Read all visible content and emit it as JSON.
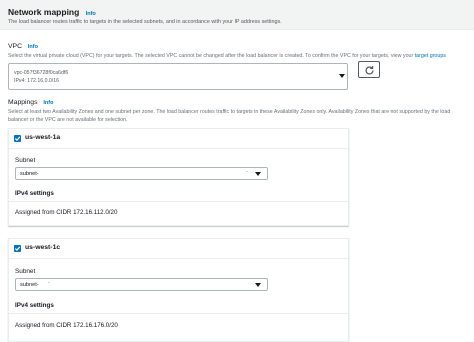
{
  "section": {
    "title": "Network mapping",
    "info": "Info",
    "description": "The load balancer routes traffic to targets in the selected subnets, and in accordance with your IP address settings."
  },
  "vpc": {
    "label": "VPC",
    "info": "Info",
    "description_before": "Select the virtual private cloud (VPC) for your targets. The selected VPC cannot be changed after the load balancer is created. To confirm the VPC for your targets, view your ",
    "description_link": "target groups",
    "selected_id": "vpc-057f36728f0ca6df6",
    "selected_cidr": "IPv4: 172.16.0.0/16"
  },
  "mappings": {
    "label": "Mappings",
    "info": "Info",
    "description": "Select at least two Availability Zones and one subnet per zone. The load balancer routes traffic to targets in these Availability Zones only. Availability Zones that are not supported by the load balancer or the VPC are not available for selection.",
    "zones": [
      {
        "name": "us-west-1a",
        "subnet_label": "Subnet",
        "subnet_value": "subnet-",
        "ipv4_title": "IPv4 settings",
        "assigned_cidr": "Assigned from CIDR 172.16.112.0/20"
      },
      {
        "name": "us-west-1c",
        "subnet_label": "Subnet",
        "subnet_value": "subnet-",
        "ipv4_title": "IPv4 settings",
        "assigned_cidr": "Assigned from CIDR 172.16.176.0/20"
      }
    ]
  },
  "icons": {
    "refresh": "refresh-icon",
    "checkbox": "checkmark-icon",
    "dropdown": "caret-down-icon"
  },
  "colors": {
    "link": "#0073bb",
    "checkbox": "#0073bb",
    "text": "#16191f",
    "muted": "#687078"
  }
}
